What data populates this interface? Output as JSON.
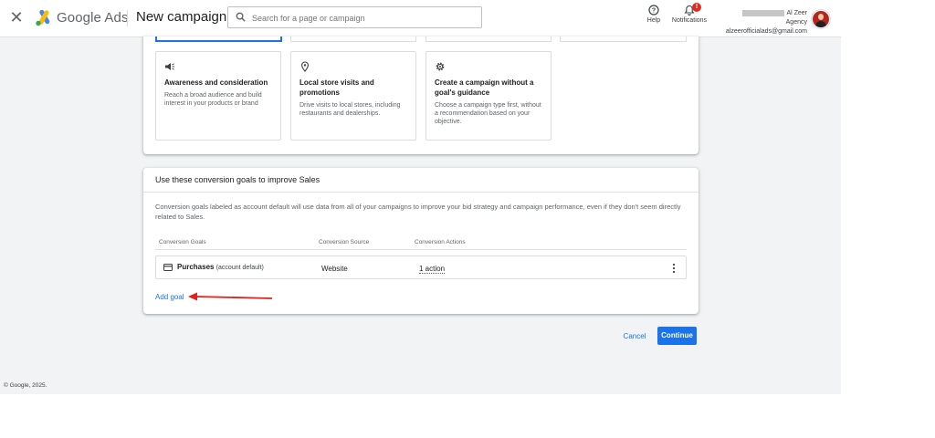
{
  "header": {
    "brand": "Google Ads",
    "page_title": "New campaign",
    "search_placeholder": "Search for a page or campaign",
    "help_label": "Help",
    "notifications_label": "Notifications",
    "notifications_badge": "!",
    "account_name": "Al Zeer Agency",
    "account_email": "alzeerofficialads@gmail.com"
  },
  "objectives": [
    {
      "title": "Awareness and consideration",
      "description": "Reach a broad audience and build interest in your products or brand",
      "icon": "megaphone-icon"
    },
    {
      "title": "Local store visits and promotions",
      "description": "Drive visits to local stores, including restaurants and dealerships.",
      "icon": "location-pin-icon"
    },
    {
      "title": "Create a campaign without a goal's guidance",
      "description": "Choose a campaign type first, without a recommendation based on your objective.",
      "icon": "gear-icon"
    }
  ],
  "conversion": {
    "title": "Use these conversion goals to improve Sales",
    "description": "Conversion goals labeled as account default will use data from all of your campaigns to improve your bid strategy and campaign performance, even if they don't seem directly related to Sales.",
    "columns": [
      "Conversion Goals",
      "Conversion Source",
      "Conversion Actions"
    ],
    "rows": [
      {
        "goal": "Purchases",
        "goal_note": "(account default)",
        "source": "Website",
        "actions": "1 action"
      }
    ],
    "add_goal_label": "Add goal"
  },
  "actions": {
    "cancel": "Cancel",
    "continue": "Continue"
  },
  "footer": "© Google, 2025.",
  "colors": {
    "accent": "#1a73e8",
    "annotation_arrow": "#e3211c",
    "badge": "#d93025"
  }
}
